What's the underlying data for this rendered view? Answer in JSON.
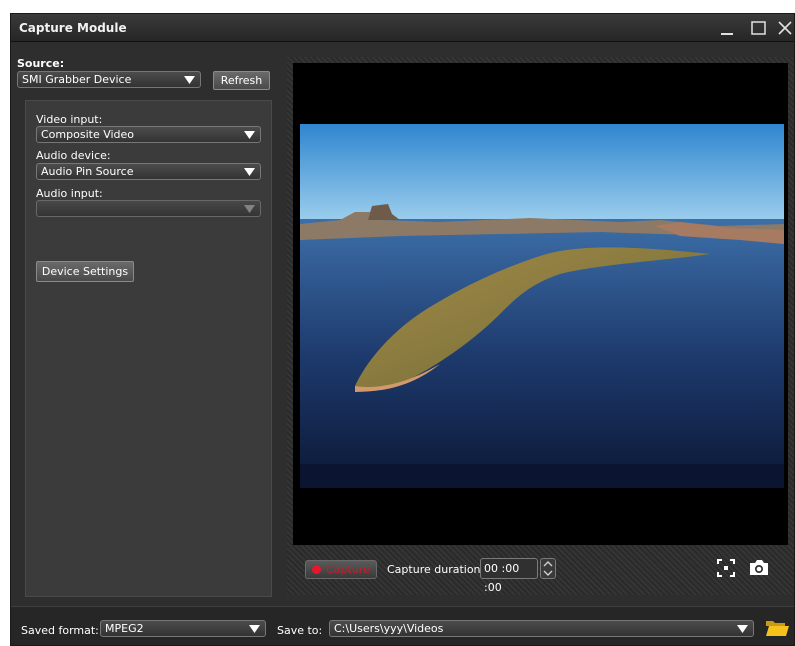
{
  "window": {
    "title": "Capture Module"
  },
  "source": {
    "label": "Source:",
    "device": "SMI Grabber Device",
    "refresh_label": "Refresh"
  },
  "video_input": {
    "label": "Video input:",
    "value": "Composite Video"
  },
  "audio_device": {
    "label": "Audio device:",
    "value": "Audio Pin Source"
  },
  "audio_input": {
    "label": "Audio input:",
    "value": ""
  },
  "device_settings_label": "Device Settings",
  "capture": {
    "button_label": "Capture",
    "duration_label": "Capture duration:",
    "duration_value": "00 :00 :00"
  },
  "bottom": {
    "format_label": "Saved format:",
    "format_value": "MPEG2",
    "save_to_label": "Save to:",
    "save_to_value": "C:\\Users\\yyy\\Videos"
  },
  "colors": {
    "window_bg": "#2e2e2e",
    "capture_red": "#e8162b",
    "folder_yellow": "#f4c21b"
  },
  "icons": {
    "minimize": "minimize-icon",
    "maximize": "maximize-icon",
    "close": "close-icon",
    "snapshot_area": "fullscreen-icon",
    "camera": "camera-icon",
    "folder": "folder-icon"
  }
}
